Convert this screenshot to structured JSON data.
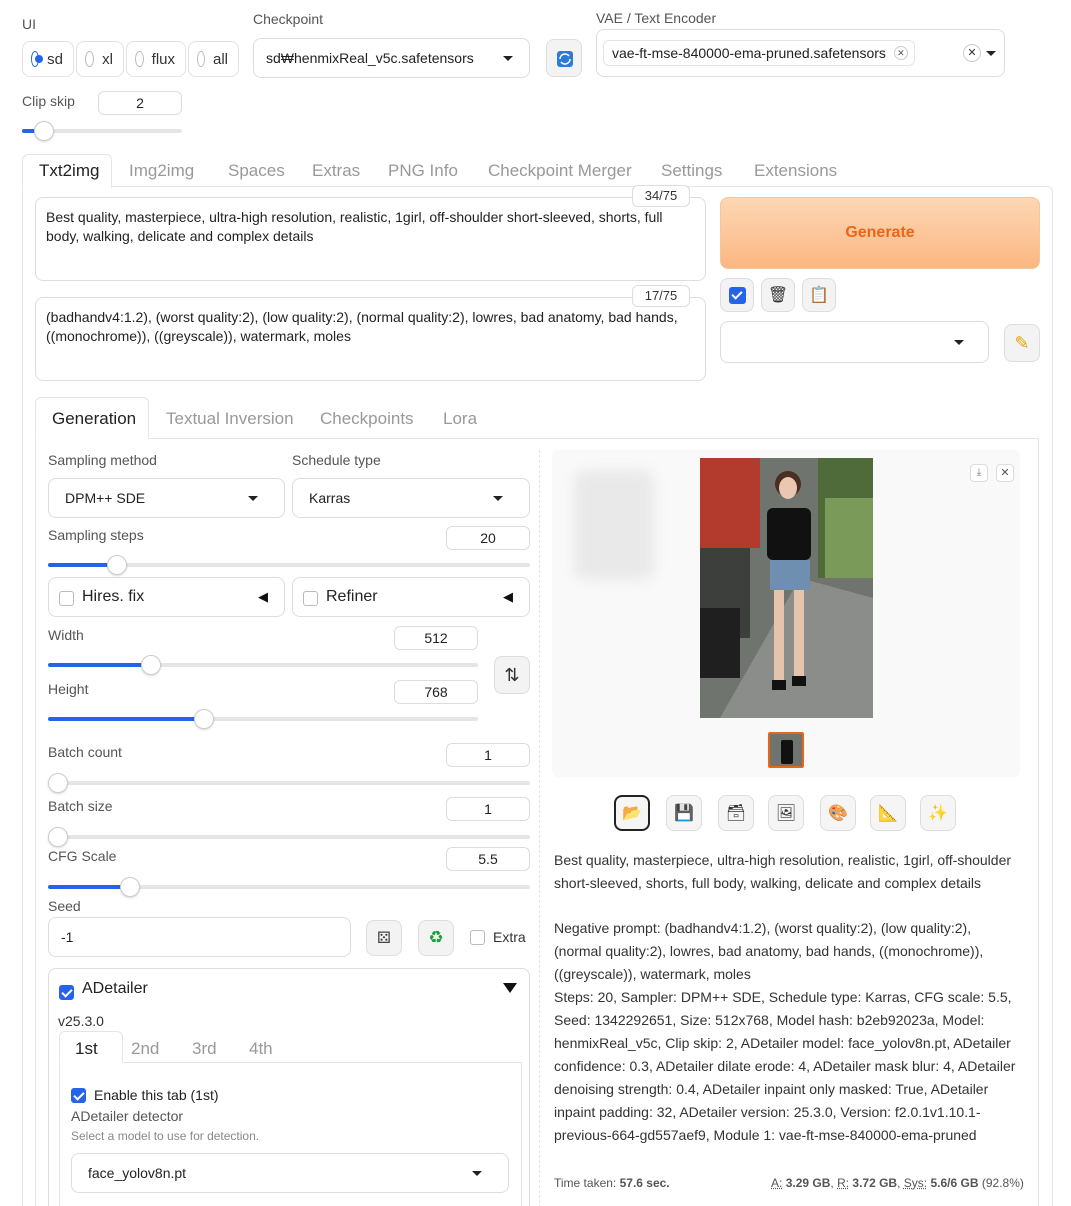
{
  "top": {
    "ui_label": "UI",
    "ui_options": [
      "sd",
      "xl",
      "flux",
      "all"
    ],
    "ui_selected": "sd",
    "checkpoint_label": "Checkpoint",
    "checkpoint_value": "sd₩henmixReal_v5c.safetensors",
    "vae_label": "VAE / Text Encoder",
    "vae_chip": "vae-ft-mse-840000-ema-pruned.safetensors",
    "clip_skip_label": "Clip skip",
    "clip_skip_value": "2",
    "clip_skip_fraction": 0.1
  },
  "tabs": [
    "Txt2img",
    "Img2img",
    "Spaces",
    "Extras",
    "PNG Info",
    "Checkpoint Merger",
    "Settings",
    "Extensions"
  ],
  "prompt": {
    "positive": "Best quality, masterpiece, ultra-high resolution, realistic, 1girl, off-shoulder short-sleeved, shorts, full body, walking, delicate and complex details",
    "positive_count": "34/75",
    "negative": "(badhandv4:1.2), (worst quality:2), (low quality:2), (normal quality:2), lowres, bad anatomy, bad hands, ((monochrome)), ((greyscale)), watermark, moles",
    "negative_count": "17/75",
    "generate_label": "Generate"
  },
  "subtabs": [
    "Generation",
    "Textual Inversion",
    "Checkpoints",
    "Lora"
  ],
  "gen": {
    "sampling_method_label": "Sampling method",
    "sampling_method": "DPM++ SDE",
    "schedule_type_label": "Schedule type",
    "schedule_type": "Karras",
    "steps_label": "Sampling steps",
    "steps": "20",
    "hires_label": "Hires. fix",
    "refiner_label": "Refiner",
    "width_label": "Width",
    "width": "512",
    "height_label": "Height",
    "height": "768",
    "batch_count_label": "Batch count",
    "batch_count": "1",
    "batch_size_label": "Batch size",
    "batch_size": "1",
    "cfg_label": "CFG Scale",
    "cfg": "5.5",
    "seed_label": "Seed",
    "seed": "-1",
    "extra_label": "Extra"
  },
  "adetailer": {
    "title": "ADetailer",
    "version": "v25.3.0",
    "tabs": [
      "1st",
      "2nd",
      "3rd",
      "4th"
    ],
    "enable_label": "Enable this tab (1st)",
    "detector_label": "ADetailer detector",
    "detector_hint": "Select a model to use for detection.",
    "detector_value": "face_yolov8n.pt"
  },
  "output": {
    "info_line1": "Best quality, masterpiece, ultra-high resolution, realistic, 1girl, off-shoulder short-sleeved, shorts, full body, walking, delicate and complex details",
    "info_line2": "Negative prompt: (badhandv4:1.2), (worst quality:2), (low quality:2), (normal quality:2), lowres, bad anatomy, bad hands, ((monochrome)), ((greyscale)), watermark, moles",
    "info_line3": "Steps: 20, Sampler: DPM++ SDE, Schedule type: Karras, CFG scale: 5.5, Seed: 1342292651, Size: 512x768, Model hash: b2eb92023a, Model: henmixReal_v5c, Clip skip: 2, ADetailer model: face_yolov8n.pt, ADetailer confidence: 0.3, ADetailer dilate erode: 4, ADetailer mask blur: 4, ADetailer denoising strength: 0.4, ADetailer inpaint only masked: True, ADetailer inpaint padding: 32, ADetailer version: 25.3.0, Version: f2.0.1v1.10.1-previous-664-gd557aef9, Module 1: vae-ft-mse-840000-ema-pruned",
    "time_label": "Time taken:",
    "time_value": "57.6 sec.",
    "a_label": "A:",
    "a_value": "3.29 GB",
    "r_label": "R:",
    "r_value": "3.72 GB",
    "sys_label": "Sys:",
    "sys_value": "5.6/6 GB",
    "sys_pct": "(92.8%)"
  }
}
